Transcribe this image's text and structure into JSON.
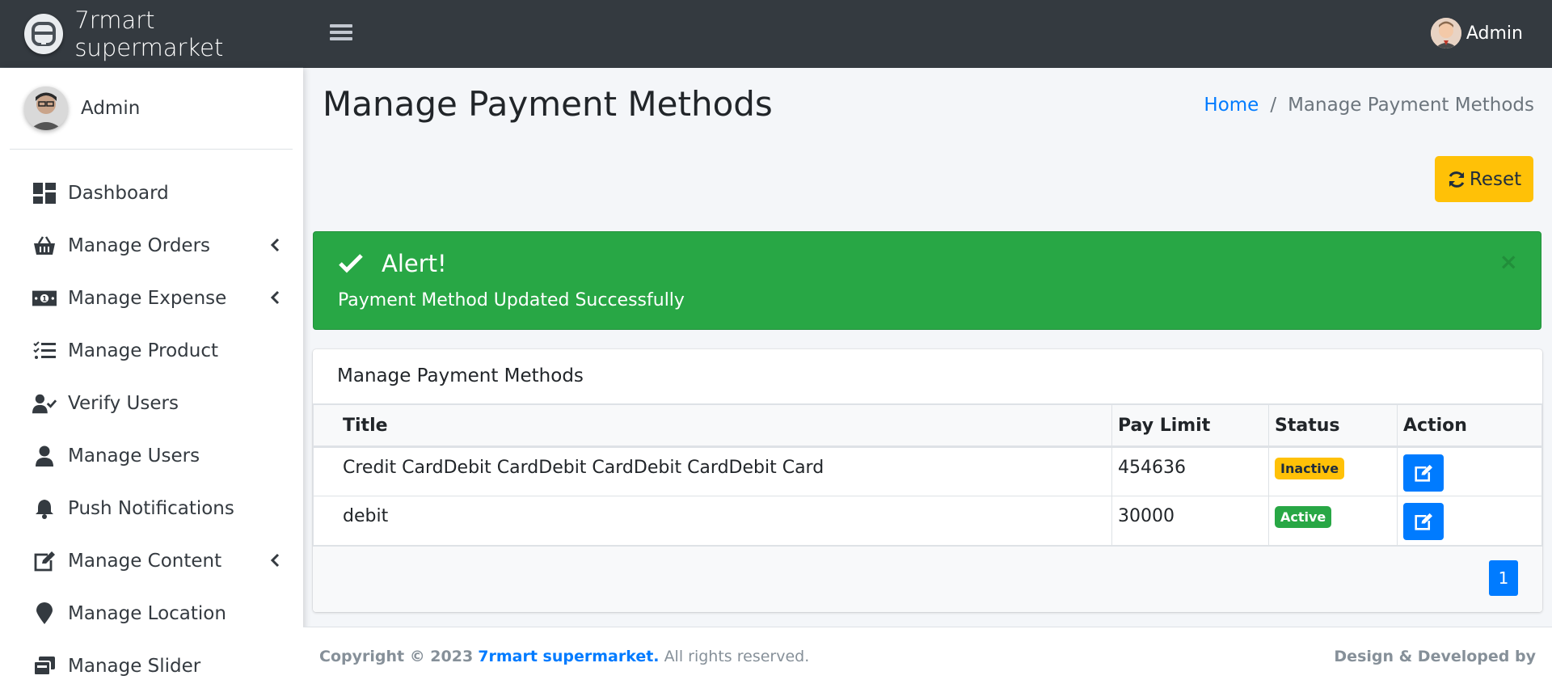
{
  "navbar": {
    "brand_name": "7rmart supermarket",
    "user_name": "Admin"
  },
  "sidebar": {
    "user_name": "Admin",
    "items": [
      {
        "label": "Dashboard",
        "icon": "dashboard-icon",
        "has_children": false
      },
      {
        "label": "Manage Orders",
        "icon": "basket-icon",
        "has_children": true
      },
      {
        "label": "Manage Expense",
        "icon": "money-bill-icon",
        "has_children": true
      },
      {
        "label": "Manage Product",
        "icon": "tasks-icon",
        "has_children": false
      },
      {
        "label": "Verify Users",
        "icon": "user-check-icon",
        "has_children": false
      },
      {
        "label": "Manage Users",
        "icon": "user-icon",
        "has_children": false
      },
      {
        "label": "Push Notifications",
        "icon": "bell-icon",
        "has_children": false
      },
      {
        "label": "Manage Content",
        "icon": "edit-icon",
        "has_children": true
      },
      {
        "label": "Manage Location",
        "icon": "map-marker-icon",
        "has_children": false
      },
      {
        "label": "Manage Slider",
        "icon": "images-icon",
        "has_children": false
      }
    ]
  },
  "header": {
    "title": "Manage Payment Methods",
    "breadcrumb_home": "Home",
    "breadcrumb_separator": "/",
    "breadcrumb_current": "Manage Payment Methods",
    "reset_label": "Reset"
  },
  "alert": {
    "title": "Alert!",
    "message": "Payment Method Updated Successfully",
    "close": "×"
  },
  "card": {
    "title": "Manage Payment Methods",
    "columns": [
      "Title",
      "Pay Limit",
      "Status",
      "Action"
    ],
    "rows": [
      {
        "title": "Credit CardDebit CardDebit CardDebit CardDebit Card",
        "pay_limit": "454636",
        "status": "Inactive"
      },
      {
        "title": "debit",
        "pay_limit": "30000",
        "status": "Active"
      }
    ],
    "page": "1"
  },
  "footer": {
    "copyright": "Copyright © 2023",
    "brand_link": "7rmart supermarket.",
    "rights": "All rights reserved.",
    "right_text": "Design & Developed by"
  },
  "colors": {
    "navbar": "#343a40",
    "primary": "#007bff",
    "success": "#28a745",
    "warning": "#ffc107"
  }
}
